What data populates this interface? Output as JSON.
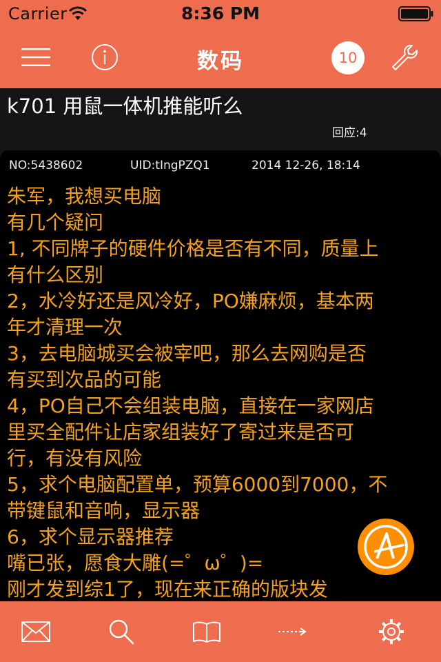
{
  "status_bar": {
    "carrier": "Carrier",
    "time": "8:36 PM"
  },
  "nav": {
    "title": "数码",
    "badge_count": "10",
    "icons": [
      "menu-icon",
      "info-icon",
      "wrench-icon"
    ]
  },
  "topic": {
    "title": "k701 用鼠一体机推能听么",
    "reply_count": "回应:4"
  },
  "post": {
    "no": "NO:5438602",
    "uid": "UID:tIngPZQ1",
    "time": "2014 12-26, 18:14",
    "lines": [
      "朱军，我想买电脑",
      "有几个疑问",
      "1, 不同牌子的硬件价格是否有不同，质量上",
      "有什么区别",
      "2，水冷好还是风冷好，PO嫌麻烦，基本两",
      "年才清理一次",
      "3，去电脑城买会被宰吧，那么去网购是否",
      "有买到次品的可能",
      "4，PO自己不会组装电脑，直接在一家网店",
      "里买全配件让店家组装好了寄过来是否可",
      "行，有没有风险",
      "5，求个电脑配置单，预算6000到7000，不",
      "带键鼠和音响，显示器",
      "6，求个显示器推荐",
      "嘴已张，愿食大雕(=゜ω゜)=",
      "刚才发到综1了，现在来正确的版块发"
    ]
  },
  "toolbar": {
    "icons": [
      "mail-icon",
      "search-icon",
      "book-icon",
      "arrow-right-icon",
      "gear-icon"
    ]
  },
  "colors": {
    "accent": "#ee6d4e",
    "post_text": "#f4a11d",
    "background": "#151515",
    "card": "#000000",
    "logo": "#ff8f00"
  }
}
